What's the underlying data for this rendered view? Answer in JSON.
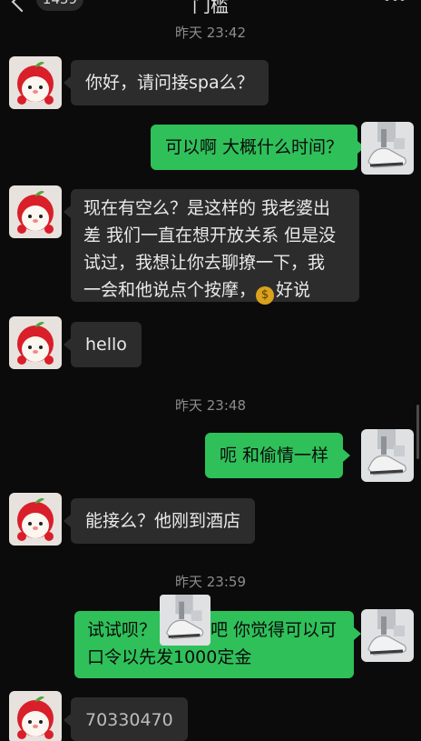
{
  "header": {
    "back_badge": "1459",
    "title": "门槛"
  },
  "timestamps": [
    "昨天 23:42",
    "昨天 23:48",
    "昨天 23:59"
  ],
  "messages": [
    {
      "side": "in",
      "text": "你好，请问接spa么？"
    },
    {
      "side": "out",
      "text": "可以啊 大概什么时间？"
    },
    {
      "side": "in",
      "lines": [
        "现在有空么？是这样的 我老婆出",
        "差 我们一直在想开放关系 但是没",
        "试过，我想让你去聊撩一下，我",
        "一会和他说点个按摩，"
      ],
      "suffix": "好说"
    },
    {
      "side": "in",
      "text": "hello"
    },
    {
      "side": "out",
      "text": "呃 和偷情一样"
    },
    {
      "side": "in",
      "text": "能接么？他刚到酒店"
    },
    {
      "side": "out",
      "lines": [
        "试试呗？",
        "吧 你觉得可以可",
        "口令以先发1000定金"
      ]
    },
    {
      "side": "in",
      "text": "70330470"
    }
  ],
  "icons": {
    "incoming_avatar": "apple-mascot-avatar-icon",
    "outgoing_avatar": "sneaker-photo-avatar-icon",
    "money": "money-bag-emoji-icon"
  },
  "colors": {
    "background": "#0b0b0b",
    "incoming_bubble": "#2c2c2c",
    "outgoing_bubble": "#2fc05a"
  }
}
